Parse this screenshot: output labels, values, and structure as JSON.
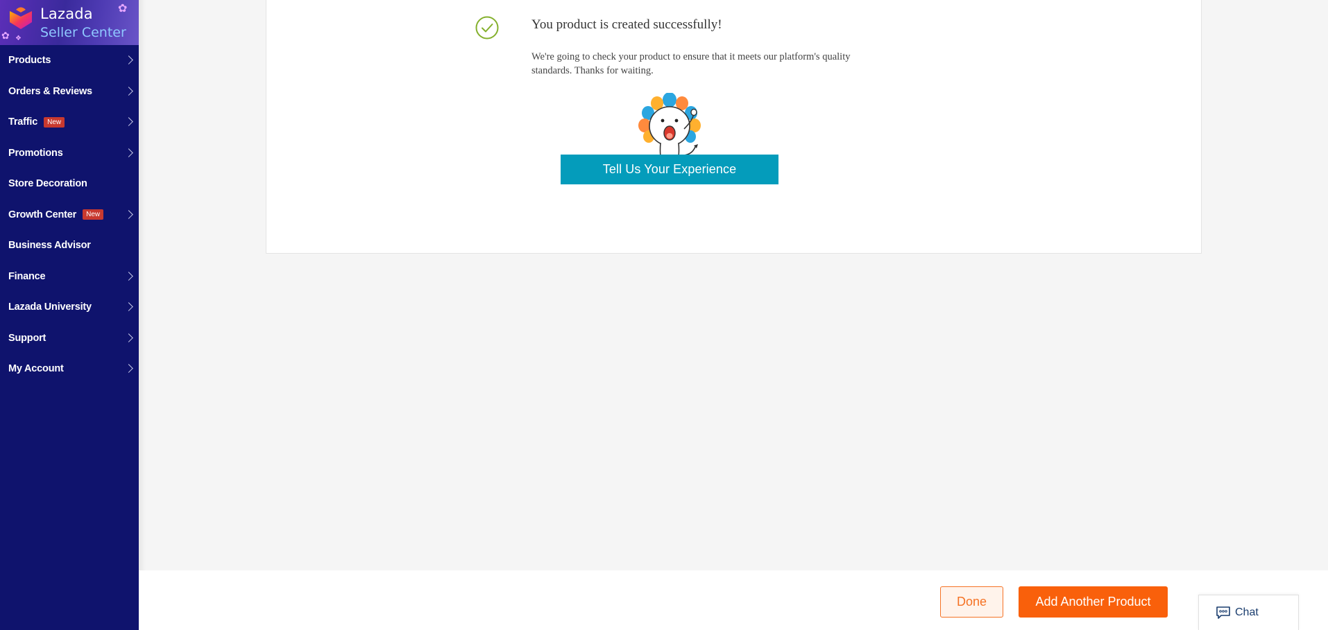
{
  "brand": {
    "name": "Lazada",
    "subtitle": "Seller Center"
  },
  "sidebar": {
    "items": [
      {
        "label": "Products",
        "has_chevron": true
      },
      {
        "label": "Orders & Reviews",
        "has_chevron": true
      },
      {
        "label": "Traffic",
        "badge": "New",
        "has_chevron": true
      },
      {
        "label": "Promotions",
        "has_chevron": true
      },
      {
        "label": "Store Decoration",
        "has_chevron": false
      },
      {
        "label": "Growth Center",
        "badge": "New",
        "has_chevron": true
      },
      {
        "label": "Business Advisor",
        "has_chevron": false
      },
      {
        "label": "Finance",
        "has_chevron": true
      },
      {
        "label": "Lazada University",
        "has_chevron": true
      },
      {
        "label": "Support",
        "has_chevron": true
      },
      {
        "label": "My Account",
        "has_chevron": true
      }
    ]
  },
  "main": {
    "success_title": "You product is created successfully!",
    "success_desc_line1": "We're going to check your product to ensure that it meets our platform's quality",
    "success_desc_line2": "standards. Thanks for waiting.",
    "feedback_button": "Tell Us Your Experience"
  },
  "footer": {
    "done_label": "Done",
    "add_label": "Add Another Product"
  },
  "chat": {
    "label": "Chat"
  },
  "colors": {
    "sidebar_bg": "#0f136d",
    "accent_orange": "#f9600b",
    "feedback_teal": "#049cbb",
    "success_green": "#84b02c",
    "badge_red": "#c8392f"
  }
}
